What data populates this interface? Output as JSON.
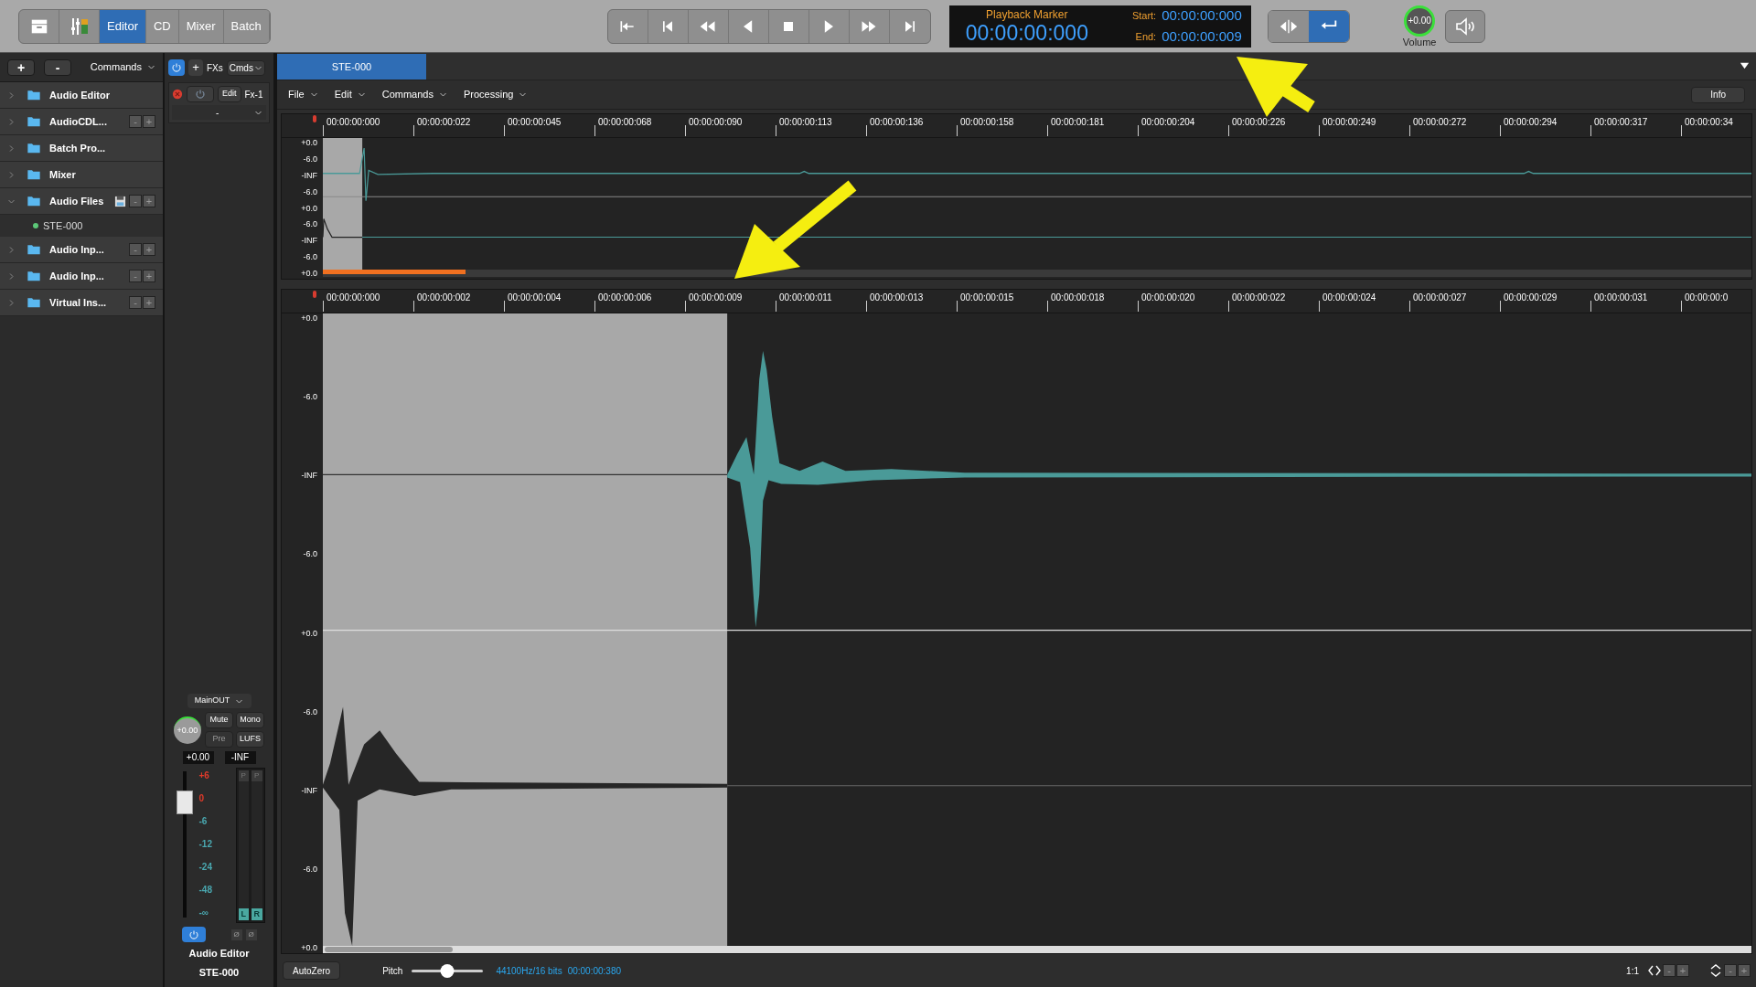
{
  "toolbar": {
    "view_tabs": [
      {
        "label": "Editor",
        "selected": true
      },
      {
        "label": "CD",
        "selected": false
      },
      {
        "label": "Mixer",
        "selected": false
      },
      {
        "label": "Batch",
        "selected": false
      }
    ],
    "time_display": {
      "title": "Playback Marker",
      "time": "00:00:00:000",
      "start_label": "Start:",
      "start": "00:00:00:000",
      "end_label": "End:",
      "end": "00:00:00:009"
    },
    "loop_buttons": [
      {
        "selected": false
      },
      {
        "selected": true
      }
    ],
    "volume": {
      "value": "+0.00",
      "label": "Volume"
    }
  },
  "sidebar": {
    "add": "+",
    "remove": "-",
    "commands": "Commands",
    "items": [
      {
        "label": "Audio Editor",
        "expanded": false,
        "save": false
      },
      {
        "label": "AudioCDL...",
        "expanded": false,
        "save": false,
        "buttons": [
          "-",
          "+"
        ]
      },
      {
        "label": "Batch Pro...",
        "expanded": false,
        "save": false
      },
      {
        "label": "Mixer",
        "expanded": false,
        "save": false
      },
      {
        "label": "Audio Files",
        "expanded": true,
        "save": true,
        "buttons": [
          "-",
          "+"
        ],
        "children": [
          {
            "label": "STE-000",
            "color": "#5cc878"
          }
        ]
      },
      {
        "label": "Audio Inp...",
        "expanded": false,
        "save": false,
        "buttons": [
          "-",
          "+"
        ]
      },
      {
        "label": "Audio Inp...",
        "expanded": false,
        "save": false,
        "buttons": [
          "-",
          "+"
        ]
      },
      {
        "label": "Virtual Ins...",
        "expanded": false,
        "save": false,
        "buttons": [
          "-",
          "+"
        ]
      }
    ]
  },
  "fx_strip": {
    "power_on": true,
    "add": "+",
    "fxs": "FXs",
    "cmds": "Cmds",
    "slot": {
      "edit": "Edit",
      "name": "Fx-1",
      "select": "-"
    }
  },
  "channel": {
    "output": "MainOUT",
    "pan": "+0.00",
    "mute": "Mute",
    "mono": "Mono",
    "pre": "Pre",
    "lufs": "LUFS",
    "gain": "+0.00",
    "peak": "-INF",
    "fader": {
      "level": 0.79
    },
    "scale": [
      {
        "label": "+6",
        "color": "#e03a2a"
      },
      {
        "label": "0",
        "color": "#e03a2a"
      },
      {
        "label": "-6",
        "color": "#4aa8b0"
      },
      {
        "label": "-12",
        "color": "#4aa8b0"
      },
      {
        "label": "-24",
        "color": "#4aa8b0"
      },
      {
        "label": "-48",
        "color": "#4aa8b0"
      },
      {
        "label": "-∞",
        "color": "#4aa8b0"
      }
    ],
    "meters": [
      {
        "peak": "P",
        "label": "L"
      },
      {
        "peak": "P",
        "label": "R"
      }
    ],
    "phase": [
      "Ø",
      "Ø"
    ],
    "power_on": true,
    "name": "Audio Editor",
    "file": "STE-000"
  },
  "editor": {
    "tab": {
      "label": "STE-000",
      "selected": true
    },
    "menu": [
      "File",
      "Edit",
      "Commands",
      "Processing"
    ],
    "info": "Info",
    "overview": {
      "ruler": [
        "00:00:00:000",
        "00:00:00:022",
        "00:00:00:045",
        "00:00:00:068",
        "00:00:00:090",
        "00:00:00:113",
        "00:00:00:136",
        "00:00:00:158",
        "00:00:00:181",
        "00:00:00:204",
        "00:00:00:226",
        "00:00:00:249",
        "00:00:00:272",
        "00:00:00:294",
        "00:00:00:317",
        "00:00:00:34"
      ],
      "axis": [
        "+0.0",
        "-6.0",
        "-INF",
        "-6.0",
        "+0.0",
        "-6.0",
        "-INF",
        "-6.0",
        "+0.0"
      ]
    },
    "main": {
      "ruler": [
        "00:00:00:000",
        "00:00:00:002",
        "00:00:00:004",
        "00:00:00:006",
        "00:00:00:009",
        "00:00:00:011",
        "00:00:00:013",
        "00:00:00:015",
        "00:00:00:018",
        "00:00:00:020",
        "00:00:00:022",
        "00:00:00:024",
        "00:00:00:027",
        "00:00:00:029",
        "00:00:00:031",
        "00:00:00:0"
      ],
      "axis": [
        "+0.0",
        "-6.0",
        "-INF",
        "-6.0",
        "+0.0",
        "-6.0",
        "-INF",
        "-6.0",
        "+0.0"
      ]
    }
  },
  "status_bar": {
    "autozero": "AutoZero",
    "pitch_label": "Pitch",
    "pitch": {
      "level": 0.5
    },
    "format": "44100Hz/16 bits",
    "duration": "00:00:00:380",
    "zoom": "1:1",
    "h_zoom": [
      "-",
      "+"
    ],
    "v_zoom": [
      "-",
      "+"
    ]
  }
}
